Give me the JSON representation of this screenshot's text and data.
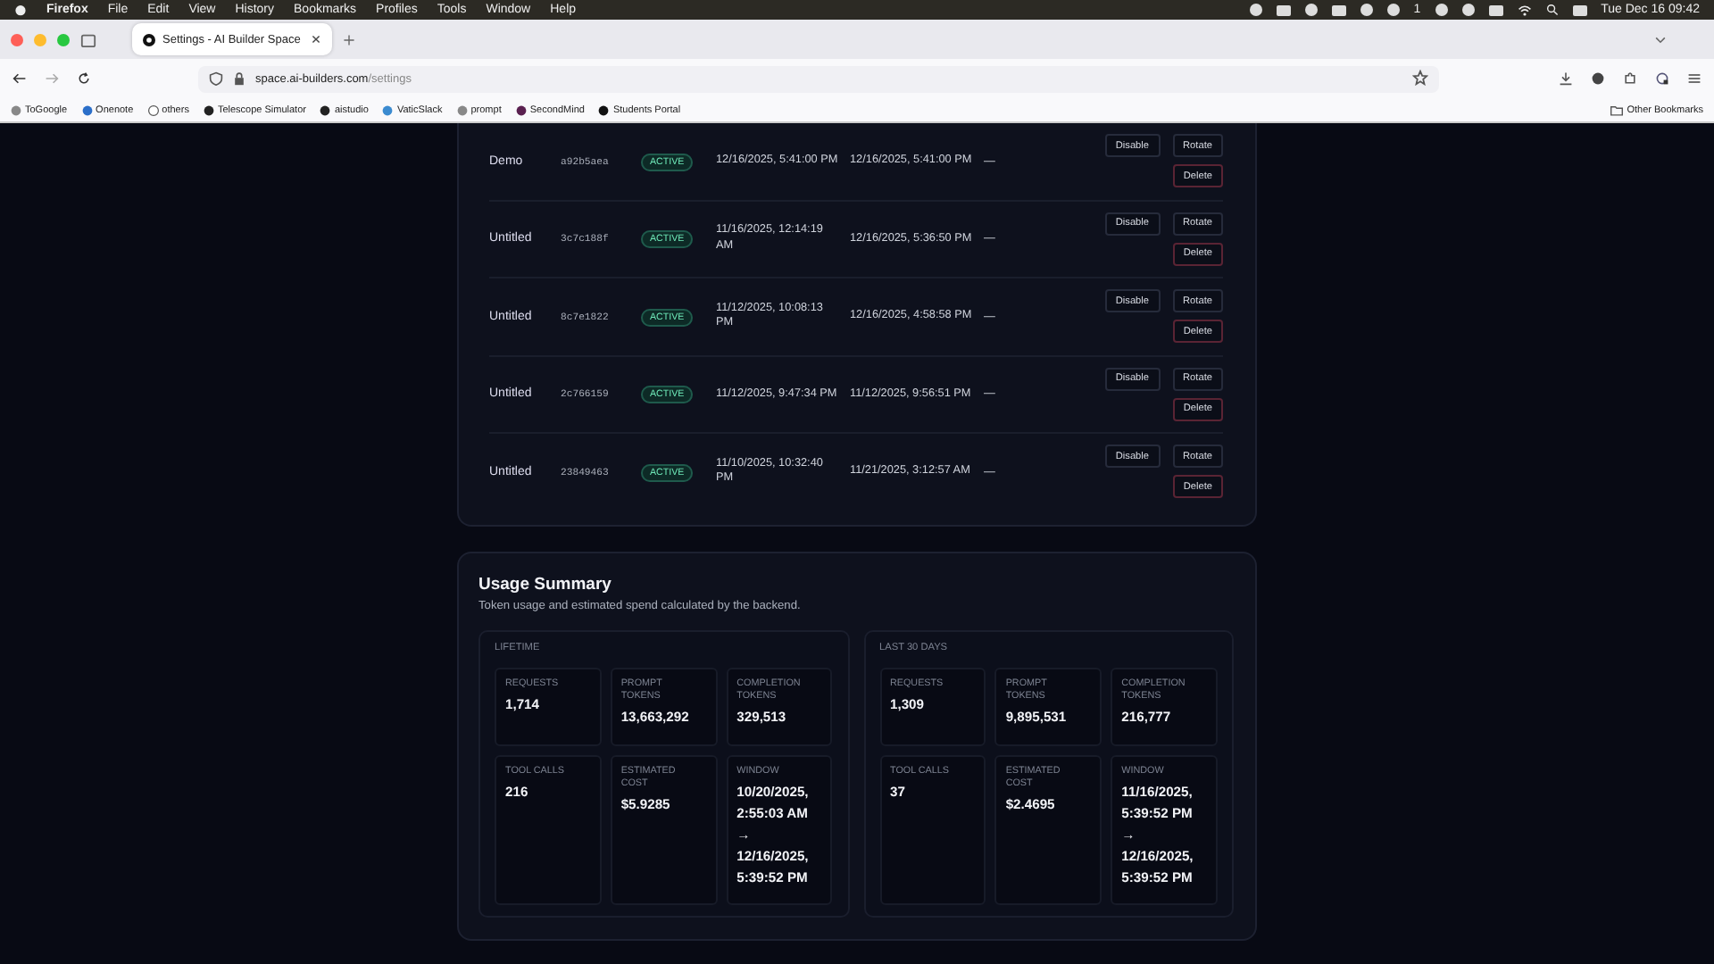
{
  "menu_bar": {
    "app": "Firefox",
    "items": [
      "File",
      "Edit",
      "View",
      "History",
      "Bookmarks",
      "Profiles",
      "Tools",
      "Window",
      "Help"
    ],
    "badge_count": "1",
    "clock": "Tue Dec 16  09:42"
  },
  "browser": {
    "tab_title": "Settings - AI Builder Space",
    "url_host": "space.ai-builders.com",
    "url_path": "/settings",
    "bookmarks": [
      "ToGoogle",
      "Onenote",
      "others",
      "Telescope Simulator",
      "aistudio",
      "VaticSlack",
      "prompt",
      "SecondMind",
      "Students Portal"
    ],
    "other_bookmarks": "Other Bookmarks"
  },
  "keys": {
    "rows": [
      {
        "name": "Demo",
        "key": "a92b5aea",
        "status": "ACTIVE",
        "created": "12/16/2025, 5:41:00 PM",
        "last_used": "12/16/2025, 5:41:00 PM",
        "expires": "—",
        "actions": [
          "Disable",
          "Rotate",
          "Delete"
        ]
      },
      {
        "name": "Untitled",
        "key": "3c7c188f",
        "status": "ACTIVE",
        "created": "11/16/2025, 12:14:19 AM",
        "last_used": "12/16/2025, 5:36:50 PM",
        "expires": "—",
        "actions": [
          "Disable",
          "Rotate",
          "Delete"
        ]
      },
      {
        "name": "Untitled",
        "key": "8c7e1822",
        "status": "ACTIVE",
        "created": "11/12/2025, 10:08:13 PM",
        "last_used": "12/16/2025, 4:58:58 PM",
        "expires": "—",
        "actions": [
          "Disable",
          "Rotate",
          "Delete"
        ]
      },
      {
        "name": "Untitled",
        "key": "2c766159",
        "status": "ACTIVE",
        "created": "11/12/2025, 9:47:34 PM",
        "last_used": "11/12/2025, 9:56:51 PM",
        "expires": "—",
        "actions": [
          "Disable",
          "Rotate",
          "Delete"
        ]
      },
      {
        "name": "Untitled",
        "key": "23849463",
        "status": "ACTIVE",
        "created": "11/10/2025, 10:32:40 PM",
        "last_used": "11/21/2025, 3:12:57 AM",
        "expires": "—",
        "actions": [
          "Disable",
          "Rotate",
          "Delete"
        ]
      }
    ]
  },
  "usage_summary": {
    "title": "Usage Summary",
    "subtitle": "Token usage and estimated spend calculated by the backend.",
    "panels": [
      {
        "label": "LIFETIME",
        "stats": [
          {
            "label": "REQUESTS",
            "value": "1,714"
          },
          {
            "label": "PROMPT TOKENS",
            "value": "13,663,292"
          },
          {
            "label": "COMPLETION TOKENS",
            "value": "329,513"
          },
          {
            "label": "TOOL CALLS",
            "value": "216"
          },
          {
            "label": "ESTIMATED COST",
            "value": "$5.9285"
          },
          {
            "label": "WINDOW",
            "value": "10/20/2025, 2:55:03 AM → 12/16/2025, 5:39:52 PM"
          }
        ]
      },
      {
        "label": "LAST 30 DAYS",
        "stats": [
          {
            "label": "REQUESTS",
            "value": "1,309"
          },
          {
            "label": "PROMPT TOKENS",
            "value": "9,895,531"
          },
          {
            "label": "COMPLETION TOKENS",
            "value": "216,777"
          },
          {
            "label": "TOOL CALLS",
            "value": "37"
          },
          {
            "label": "ESTIMATED COST",
            "value": "$2.4695"
          },
          {
            "label": "WINDOW",
            "value": "11/16/2025, 5:39:52 PM → 12/16/2025, 5:39:52 PM"
          }
        ]
      }
    ]
  }
}
